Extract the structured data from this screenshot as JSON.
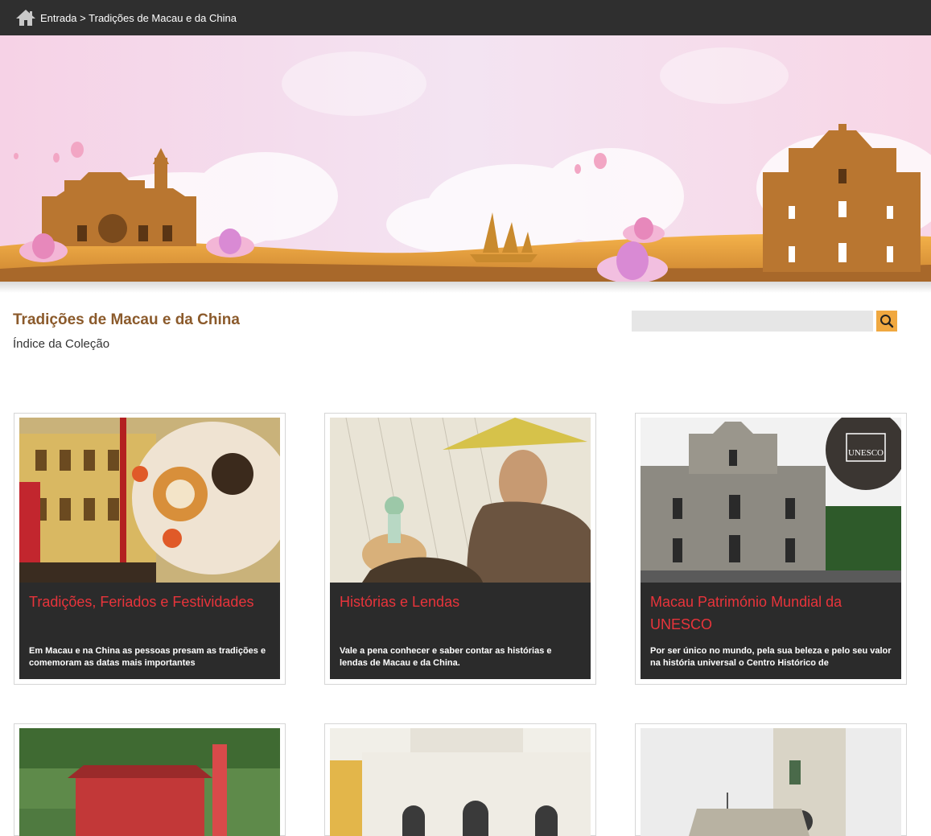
{
  "breadcrumb": {
    "home_icon": "home-icon",
    "home_label": "Entrada",
    "separator": ">",
    "current": "Tradições de Macau e da China"
  },
  "header": {
    "title": "Tradições de Macau e da China",
    "subtitle": "Índice da Coleção"
  },
  "search": {
    "placeholder": "",
    "button_icon": "search-icon",
    "button_color": "#f0a840"
  },
  "colors": {
    "topbar": "#2f2f2f",
    "title": "#8b5a2b",
    "card_caption_bg": "#2b2b2b",
    "card_title": "#e8343b"
  },
  "cards": [
    {
      "title": "Tradições, Feriados e Festividades",
      "description": "Em Macau e na China as pessoas presam as tradições e comemoram as datas mais importantes"
    },
    {
      "title": "Histórias e Lendas",
      "description": "Vale a pena conhecer e saber contar as histórias e lendas de Macau e da China."
    },
    {
      "title": "Macau Património Mundial da UNESCO",
      "description": "Por ser único no mundo, pela sua beleza e pelo seu valor na história universal o Centro Histórico de"
    }
  ],
  "unesco_badge": "UNESCO"
}
